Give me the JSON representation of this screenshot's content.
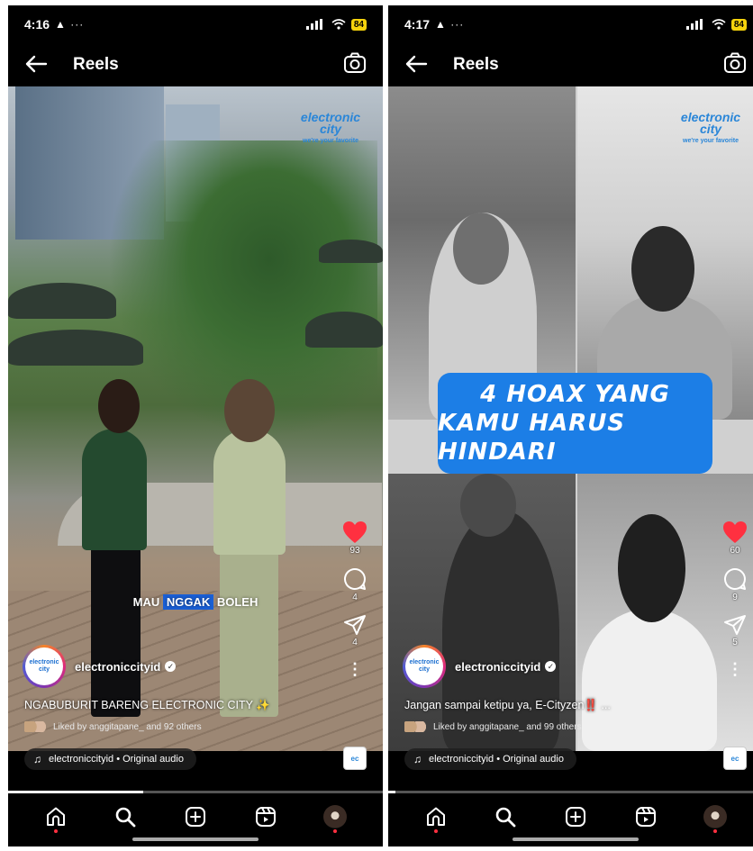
{
  "screens": [
    {
      "status": {
        "time": "4:16",
        "left_icons": "▲ ···",
        "battery": "84"
      },
      "header": {
        "title": "Reels",
        "back_icon": "back-arrow-icon",
        "camera_icon": "camera-icon"
      },
      "reel": {
        "subtitle_before": "MAU ",
        "subtitle_highlight": "NGGAK",
        "subtitle_after": " BOLEH",
        "brand_watermark": "electronic city",
        "brand_tagline": "we're your favorite",
        "likes": "93",
        "comments": "4",
        "shares": "4",
        "username": "electroniccityid",
        "caption": "NGABUBURIT BARENG ELECTRONIC CITY ✨",
        "liked_by": "Liked by anggitapane_ and 92 others",
        "audio": "electroniccityid • Original audio",
        "progress": 0.36
      }
    },
    {
      "status": {
        "time": "4:17",
        "left_icons": "▲ ···",
        "battery": "84"
      },
      "header": {
        "title": "Reels",
        "back_icon": "back-arrow-icon",
        "camera_icon": "camera-icon"
      },
      "reel": {
        "banner_line1": "4 HOAX YANG",
        "banner_line2": "KAMU HARUS HINDARI",
        "brand_watermark": "electronic city",
        "brand_tagline": "we're your favorite",
        "likes": "60",
        "comments": "9",
        "shares": "5",
        "username": "electroniccityid",
        "caption": "Jangan sampai ketipu ya, E-Cityzen‼️ ...",
        "liked_by": "Liked by anggitapane_ and 99 others",
        "audio": "electroniccityid • Original audio",
        "progress": 0.02
      }
    }
  ],
  "nav_icons": [
    "home-icon",
    "search-icon",
    "create-icon",
    "reels-icon",
    "profile-icon"
  ],
  "colors": {
    "like": "#ff3040",
    "highlight": "#1a5fd6",
    "banner": "#1c7ee6",
    "brand": "#2a86d8"
  }
}
